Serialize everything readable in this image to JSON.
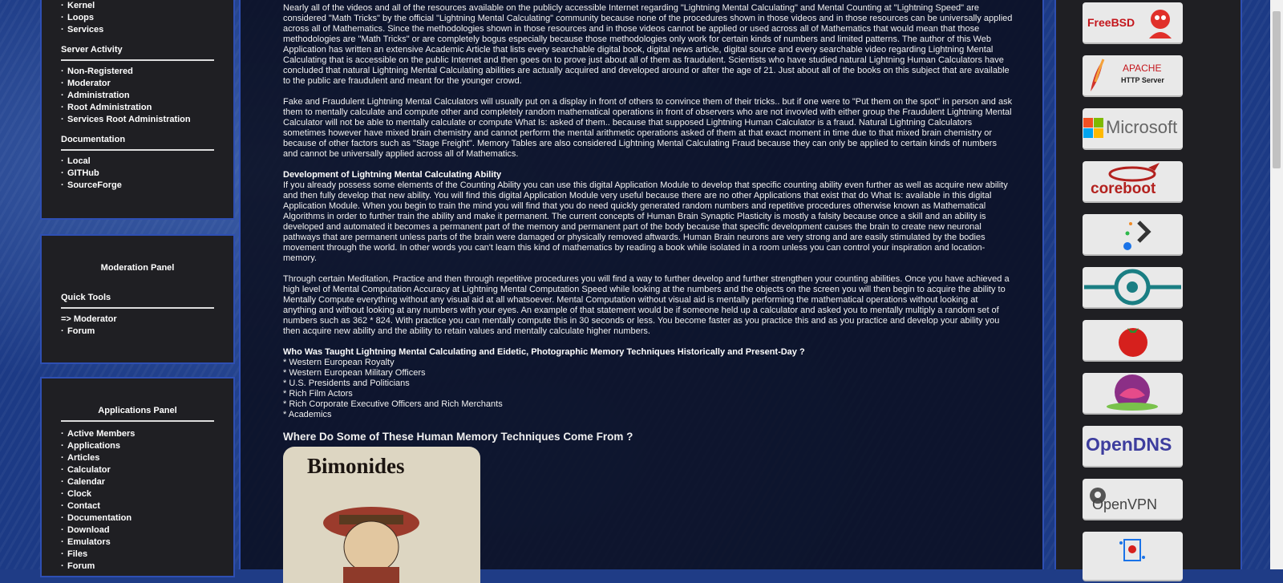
{
  "left": {
    "nav1": {
      "items": [
        "Kernel",
        "Loops",
        "Services"
      ]
    },
    "server_activity": {
      "title": "Server Activity",
      "items": [
        "Non-Registered",
        "Moderator",
        "Administration",
        "Root Administration",
        "Services Root Administration"
      ]
    },
    "documentation": {
      "title": "Documentation",
      "items": [
        "Local",
        "GITHub",
        "SourceForge"
      ]
    },
    "moderation_panel": {
      "title": "Moderation Panel",
      "quick_tools": "Quick Tools",
      "items": [
        "=> Moderator",
        "Forum"
      ]
    },
    "applications_panel": {
      "title": "Applications Panel",
      "items": [
        "Active Members",
        "Applications",
        "Articles",
        "Calculator",
        "Calendar",
        "Clock",
        "Contact",
        "Documentation",
        "Download",
        "Emulators",
        "Files",
        "Forum"
      ]
    }
  },
  "main": {
    "p1": "Nearly all of the videos and all of the resources available on the publicly accessible Internet regarding \"Lightning Mental Calculating\" and Mental Counting at \"Lightning Speed\" are considered \"Math Tricks\" by the official \"Lightning Mental Calculating\" community because none of the procedures shown in those videos and in those resources can be universally applied across all of Mathematics. Since the methodologies shown in those resources and in those videos cannot be applied or used across all of Mathematics that would mean that those methodologies are \"Math Tricks\" or are completely bogus especially because those methodologies only work for certain kinds of numbers and limited patterns. The author of this Web Application has written an extensive Academic Article that lists every searchable digital book, digital news article, digital source and every searchable video regarding Lightning Mental Calculating that is accessible on the public Internet and then goes on to prove just about all of them as fraudulent. Scientists who have studied natural Lightning Human Calculators have concluded that natural Lightning Mental Calculating abilities are actually acquired and developed around or after the age of 21. Just about all of the books on this subject that are available to the public are fraudulent and meant for the younger crowd.",
    "p2": "Fake and Fraudulent Lightning Mental Calculators will usually put on a display in front of others to convince them of their tricks.. but if one were to \"Put them on the spot\" in person and ask them to mentally calculate and compute other and completely random mathematical operations in front of observers who are not invovled with either group the Fraudulent Lightning Mental Calculator will not be able to mentally calculate or compute What Is: asked of them.. because that supposed Lightning Human Calculator is a fraud. Natural Lightning Calculators sometimes however have mixed brain chemistry and cannot perform the mental arithmetic operations asked of them at that exact moment in time due to that mixed brain chemistry or because of other factors such as \"Stage Freight\". Memory Tables are also considered Lightning Mental Calculating Fraud because they can only be applied to certain kinds of numbers and cannot be universally applied across all of Mathematics.",
    "p3_title": "Development of Lightning Mental Calculating Ability",
    "p3": "If you already possess some elements of the Counting Ability you can use this digital Application Module to develop that specific counting ability even further as well as acquire new ability and then fully develop that new ability. You will find this digital Application Module very useful because there are no other Applications that exist that do What Is: available in this digital Application Module. When you begin to train the mind you will find that you do need quickly generated random numbers and repetitive procedures otherwise known as Mathematical Algorithms in order to further train the ability and make it permanent. The current concepts of Human Brain Synaptic Plasticity is mostly a falsity because once a skill and an ability is developed and automated it becomes a permanent part of the memory and permanent part of the body because that specific development causes the brain to create new neuronal pathways that are permanent unless parts of the brain were damaged or physically removed aftwards. Human Brain neurons are very strong and are easily stimulated by the bodies movement through the world. In other words you can't learn this kind of mathematics by reading a book while isolated in a room unless you can control your inspiration and location-memory.",
    "p4": "Through certain Meditation, Practice and then through repetitive procedures you will find a way to further develop and further strengthen your counting abilities. Once you have achieved a high level of Mental Computation Accuracy at Lightning Mental Computation Speed while looking at the numbers and the objects on the screen you will then begin to acquire the ability to Mentally Compute everything without any visual aid at all whatsoever. Mental Computation without visual aid is mentally performing the mathematical operations without looking at anything and without looking at any numbers with your eyes. An example of that statement would be if someone held up a calculator and asked you to mentally multiply a random set of numbers such as 362 * 824. With practice you can mentally compute this in 30 seconds or less. You become faster as you practice this and as you practice and develop your ability you then acquire new ability and the ability to retain values and mentally calculate higher numbers.",
    "p5_title": "Who Was Taught Lightning Mental Calculating and Eidetic, Photographic Memory Techniques Historically and Present-Day ?",
    "list": [
      "* Western European Royalty",
      "* Western European Military Officers",
      "* U.S. Presidents and Politicians",
      "* Rich Film Actors",
      "* Rich Corporate Executive Officers and Rich Merchants",
      "* Academics"
    ],
    "h2": "Where Do Some of These Human Memory Techniques Come From ?",
    "portrait_name": "Bimonides"
  },
  "right": {
    "logos": [
      {
        "name": "freebsd",
        "text": "FreeBSD"
      },
      {
        "name": "apache",
        "text": "APACHE",
        "sub": "HTTP Server"
      },
      {
        "name": "microsoft",
        "text": "Microsoft"
      },
      {
        "name": "coreboot",
        "text": "coreboot"
      },
      {
        "name": "prompt",
        "text": ""
      },
      {
        "name": "circle",
        "text": ""
      },
      {
        "name": "tomato",
        "text": ""
      },
      {
        "name": "lotus",
        "text": ""
      },
      {
        "name": "opendns",
        "text": "OpenDNS"
      },
      {
        "name": "openvpn",
        "text": "OpenVPN"
      },
      {
        "name": "misc",
        "text": ""
      }
    ]
  },
  "colors": {
    "panel_border": "#2e4fb3",
    "panel_bg": "#1f1f23",
    "main_bg": "#0a0e1e"
  }
}
